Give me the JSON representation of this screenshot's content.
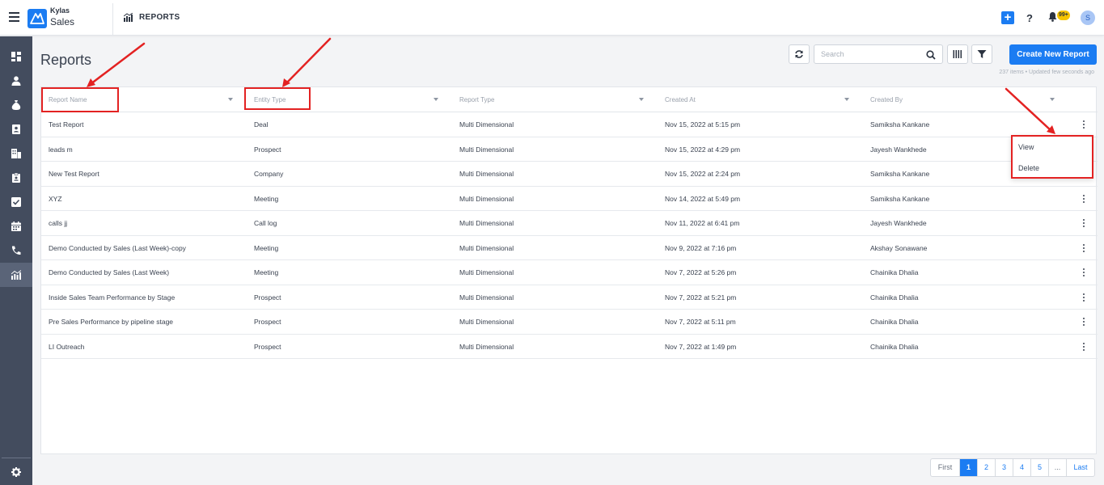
{
  "app": {
    "brand_top": "Kylas",
    "brand_bottom": "Sales",
    "breadcrumb": "REPORTS",
    "notification_badge": "99+",
    "user_initial": "S"
  },
  "page": {
    "title": "Reports",
    "search_placeholder": "Search",
    "create_button": "Create New Report",
    "meta": "237 items • Updated few seconds ago"
  },
  "table": {
    "columns": [
      "Report Name",
      "Entity Type",
      "Report Type",
      "Created At",
      "Created By"
    ],
    "rows": [
      [
        "Test Report",
        "Deal",
        "Multi Dimensional",
        "Nov 15, 2022 at 5:15 pm",
        "Samiksha Kankane"
      ],
      [
        "leads m",
        "Prospect",
        "Multi Dimensional",
        "Nov 15, 2022 at 4:29 pm",
        "Jayesh Wankhede"
      ],
      [
        "New Test Report",
        "Company",
        "Multi Dimensional",
        "Nov 15, 2022 at 2:24 pm",
        "Samiksha Kankane"
      ],
      [
        "XYZ",
        "Meeting",
        "Multi Dimensional",
        "Nov 14, 2022 at 5:49 pm",
        "Samiksha Kankane"
      ],
      [
        "calls jj",
        "Call log",
        "Multi Dimensional",
        "Nov 11, 2022 at 6:41 pm",
        "Jayesh Wankhede"
      ],
      [
        "Demo Conducted by Sales (Last Week)-copy",
        "Meeting",
        "Multi Dimensional",
        "Nov 9, 2022 at 7:16 pm",
        "Akshay Sonawane"
      ],
      [
        "Demo Conducted by Sales (Last Week)",
        "Meeting",
        "Multi Dimensional",
        "Nov 7, 2022 at 5:26 pm",
        "Chainika Dhalia"
      ],
      [
        "Inside Sales Team Performance by Stage",
        "Prospect",
        "Multi Dimensional",
        "Nov 7, 2022 at 5:21 pm",
        "Chainika Dhalia"
      ],
      [
        "Pre Sales Performance by pipeline stage",
        "Prospect",
        "Multi Dimensional",
        "Nov 7, 2022 at 5:11 pm",
        "Chainika Dhalia"
      ],
      [
        "LI Outreach",
        "Prospect",
        "Multi Dimensional",
        "Nov 7, 2022 at 1:49 pm",
        "Chainika Dhalia"
      ]
    ]
  },
  "row_menu": {
    "view": "View",
    "delete": "Delete"
  },
  "pagination": {
    "first": "First",
    "pages": [
      "1",
      "2",
      "3",
      "4",
      "5"
    ],
    "ellipsis": "...",
    "last": "Last",
    "current": "1"
  },
  "colors": {
    "accent": "#1b7cf2",
    "sidebar": "#434c5e",
    "annotation": "#e32222"
  }
}
